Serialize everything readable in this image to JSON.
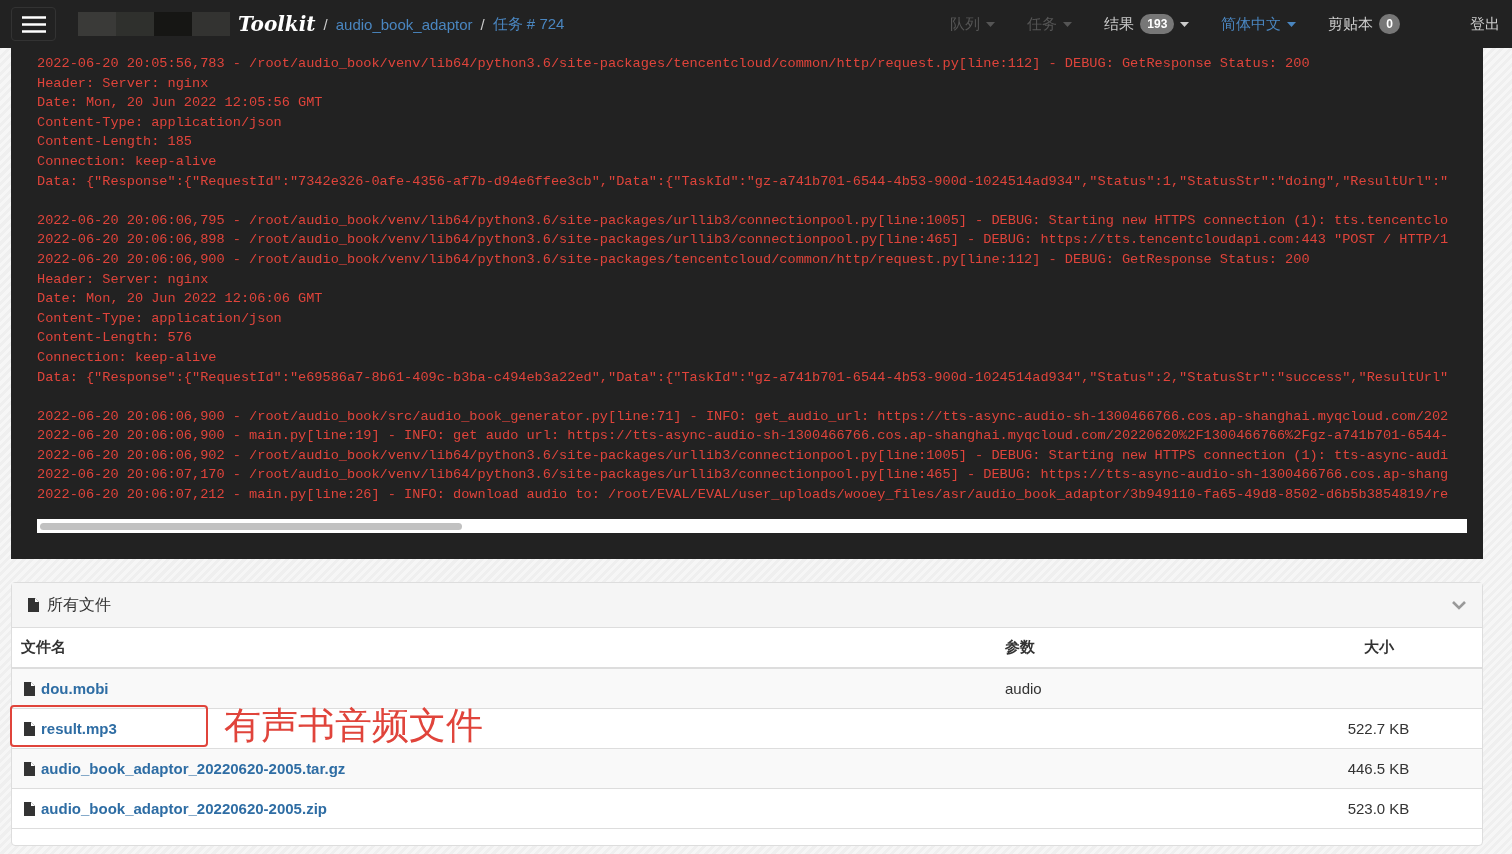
{
  "navbar": {
    "logo": "Toolkit",
    "breadcrumbs": [
      {
        "separator": "/",
        "label": "audio_book_adaptor"
      },
      {
        "separator": "/",
        "label": "任务 # 724"
      }
    ],
    "menu": [
      {
        "label": "队列",
        "disabled": true,
        "caret": true
      },
      {
        "label": "任务",
        "disabled": true,
        "caret": true
      },
      {
        "label": "结果",
        "disabled": false,
        "badge": "193",
        "caret": true
      },
      {
        "label": "简体中文",
        "disabled": false,
        "kind": "link",
        "caret": true
      },
      {
        "label": "剪贴本",
        "disabled": false,
        "badge": "0"
      },
      {
        "label": "登出",
        "disabled": false
      }
    ]
  },
  "log": {
    "blocks": [
      [
        "2022-06-20 20:05:56,783 - /root/audio_book/venv/lib64/python3.6/site-packages/tencentcloud/common/http/request.py[line:112] - DEBUG: GetResponse Status: 200",
        "Header: Server: nginx",
        "Date: Mon, 20 Jun 2022 12:05:56 GMT",
        "Content-Type: application/json",
        "Content-Length: 185",
        "Connection: keep-alive",
        "Data: {\"Response\":{\"RequestId\":\"7342e326-0afe-4356-af7b-d94e6ffee3cb\",\"Data\":{\"TaskId\":\"gz-a741b701-6544-4b53-900d-1024514ad934\",\"Status\":1,\"StatusStr\":\"doing\",\"ResultUrl\":\""
      ],
      [
        "2022-06-20 20:06:06,795 - /root/audio_book/venv/lib64/python3.6/site-packages/urllib3/connectionpool.py[line:1005] - DEBUG: Starting new HTTPS connection (1): tts.tencentclo",
        "2022-06-20 20:06:06,898 - /root/audio_book/venv/lib64/python3.6/site-packages/urllib3/connectionpool.py[line:465] - DEBUG: https://tts.tencentcloudapi.com:443 \"POST / HTTP/1",
        "2022-06-20 20:06:06,900 - /root/audio_book/venv/lib64/python3.6/site-packages/tencentcloud/common/http/request.py[line:112] - DEBUG: GetResponse Status: 200",
        "Header: Server: nginx",
        "Date: Mon, 20 Jun 2022 12:06:06 GMT",
        "Content-Type: application/json",
        "Content-Length: 576",
        "Connection: keep-alive",
        "Data: {\"Response\":{\"RequestId\":\"e69586a7-8b61-409c-b3ba-c494eb3a22ed\",\"Data\":{\"TaskId\":\"gz-a741b701-6544-4b53-900d-1024514ad934\",\"Status\":2,\"StatusStr\":\"success\",\"ResultUrl\""
      ],
      [
        "2022-06-20 20:06:06,900 - /root/audio_book/src/audio_book_generator.py[line:71] - INFO: get_audio_url: https://tts-async-audio-sh-1300466766.cos.ap-shanghai.myqcloud.com/202",
        "2022-06-20 20:06:06,900 - main.py[line:19] - INFO: get audo url: https://tts-async-audio-sh-1300466766.cos.ap-shanghai.myqcloud.com/20220620%2F1300466766%2Fgz-a741b701-6544-",
        "2022-06-20 20:06:06,902 - /root/audio_book/venv/lib64/python3.6/site-packages/urllib3/connectionpool.py[line:1005] - DEBUG: Starting new HTTPS connection (1): tts-async-audi",
        "2022-06-20 20:06:07,170 - /root/audio_book/venv/lib64/python3.6/site-packages/urllib3/connectionpool.py[line:465] - DEBUG: https://tts-async-audio-sh-1300466766.cos.ap-shang",
        "2022-06-20 20:06:07,212 - main.py[line:26] - INFO: download audio to: /root/EVAL/EVAL/user_uploads/wooey_files/asr/audio_book_adaptor/3b949110-fa65-49d8-8502-d6b5b3854819/re"
      ]
    ]
  },
  "files": {
    "title": "所有文件",
    "expanded": true,
    "columns": [
      "文件名",
      "参数",
      "大小"
    ],
    "rows": [
      {
        "name": "dou.mobi",
        "param": "audio"
      },
      {
        "name": "result.mp3",
        "size": "522.7 KB",
        "highlighted": true
      },
      {
        "name": "audio_book_adaptor_20220620-2005.tar.gz",
        "size": "446.5 KB"
      },
      {
        "name": "audio_book_adaptor_20220620-2005.zip",
        "size": "523.0 KB"
      }
    ],
    "annotation": "有声书音频文件"
  }
}
